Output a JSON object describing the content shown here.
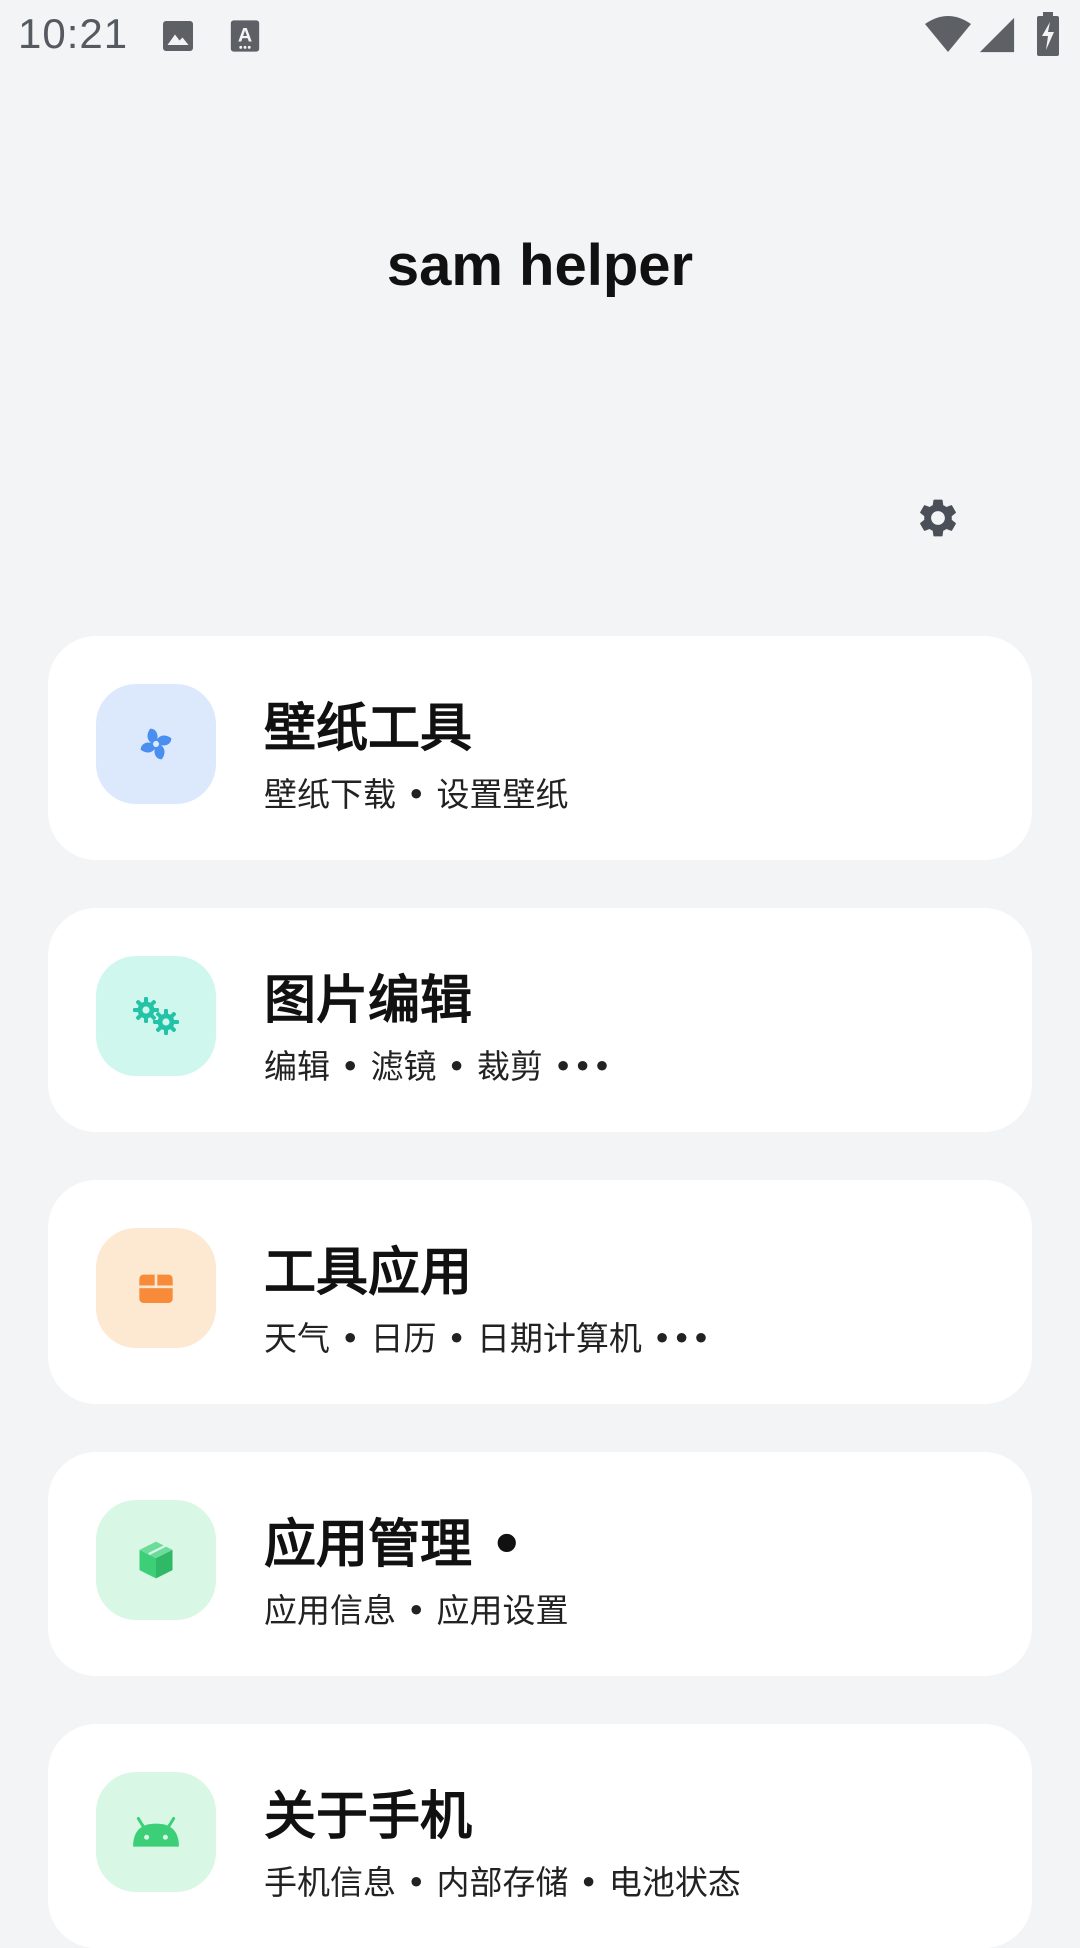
{
  "status_bar": {
    "time": "10:21",
    "icons": [
      "image-icon",
      "text-a-icon",
      "wifi-icon",
      "cell-signal-icon",
      "battery-charging-icon"
    ]
  },
  "app": {
    "title": "sam helper",
    "settings_icon": "gear-icon"
  },
  "cards": [
    {
      "title": "壁纸工具",
      "subtitle": "壁纸下载 • 设置壁纸",
      "icon": "pinwheel-icon",
      "icon_bg": "#dce9fd",
      "icon_color": "#4a8ff0"
    },
    {
      "title": "图片编辑",
      "subtitle": "编辑 • 滤镜 • 裁剪 •••",
      "icon": "gears-icon",
      "icon_bg": "#cff7ee",
      "icon_color": "#22c3a6"
    },
    {
      "title": "工具应用",
      "subtitle": "天气 • 日历 • 日期计算机 •••",
      "icon": "toolbox-icon",
      "icon_bg": "#fde8d2",
      "icon_color": "#f78b3a"
    },
    {
      "title": "应用管理 •",
      "subtitle": "应用信息 • 应用设置",
      "icon": "cube-icon",
      "icon_bg": "#d8f7e4",
      "icon_color": "#3ccf78"
    },
    {
      "title": "关于手机",
      "subtitle": "手机信息 • 内部存储 • 电池状态",
      "icon": "android-icon",
      "icon_bg": "#d8f7e4",
      "icon_color": "#3ccf78"
    }
  ]
}
